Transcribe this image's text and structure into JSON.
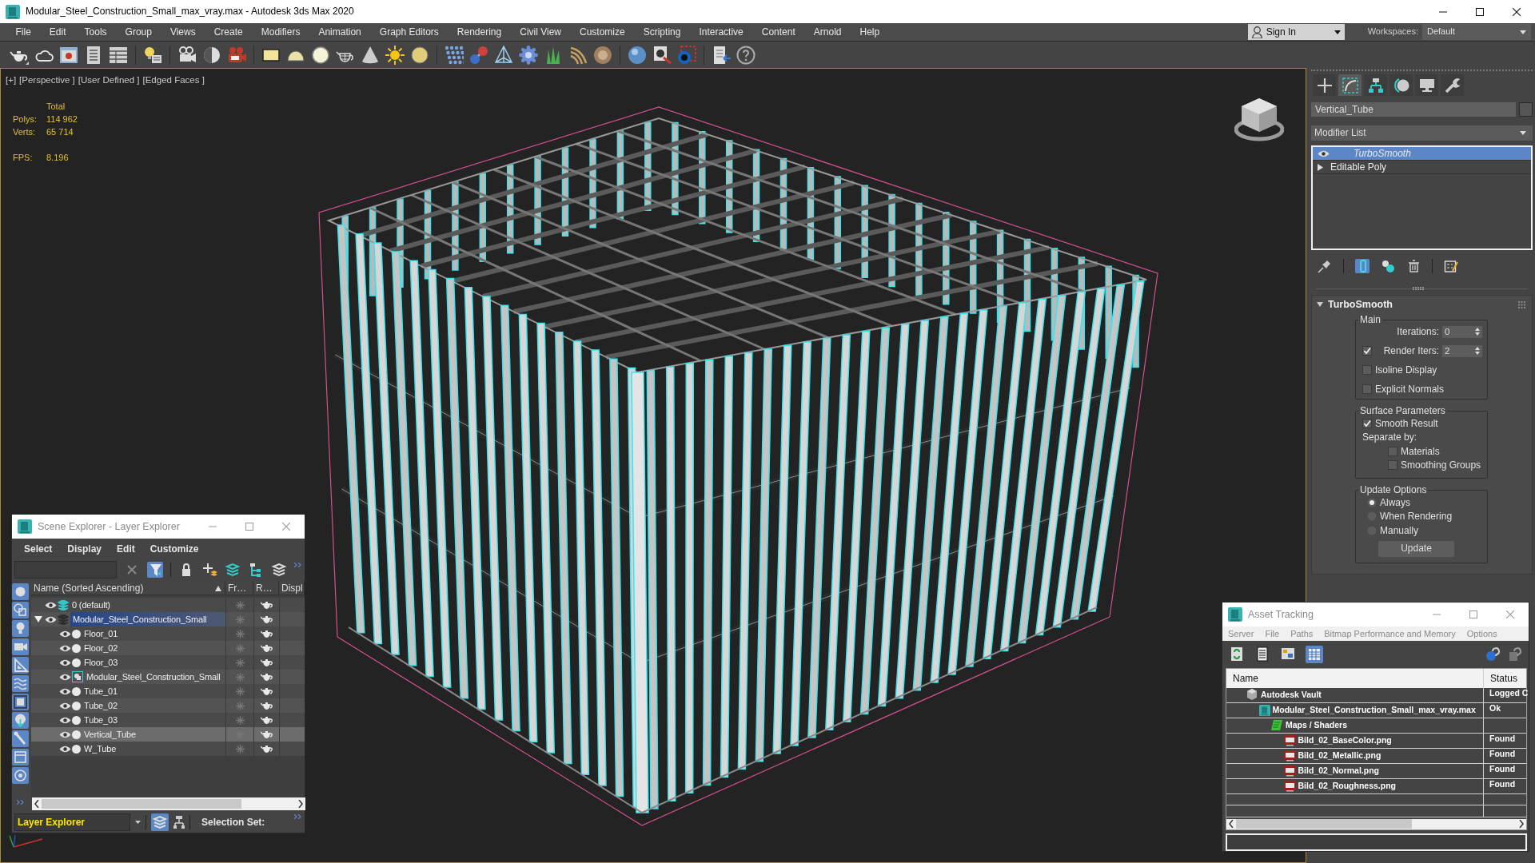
{
  "window": {
    "title": "Modular_Steel_Construction_Small_max_vray.max - Autodesk 3ds Max 2020"
  },
  "menu_bar": {
    "items": [
      "File",
      "Edit",
      "Tools",
      "Group",
      "Views",
      "Create",
      "Modifiers",
      "Animation",
      "Graph Editors",
      "Rendering",
      "Civil View",
      "Customize",
      "Scripting",
      "Interactive",
      "Content",
      "Arnold",
      "Help"
    ],
    "sign_in": "Sign In",
    "workspaces_label": "Workspaces:",
    "workspace": "Default"
  },
  "viewport": {
    "labels": [
      "[+]",
      "[Perspective ]",
      "[User Defined ]",
      "[Edged Faces ]"
    ],
    "stats_header": "Total",
    "stats": [
      {
        "label": "Polys:",
        "value": "114 962"
      },
      {
        "label": "Verts:",
        "value": "65 714"
      }
    ],
    "fps": {
      "label": "FPS:",
      "value": "8.196"
    }
  },
  "command_panel": {
    "tabs": [
      {
        "kind": "create",
        "selected": false
      },
      {
        "kind": "modify",
        "selected": true
      },
      {
        "kind": "hierarchy",
        "selected": false
      },
      {
        "kind": "motion",
        "selected": false
      },
      {
        "kind": "display",
        "selected": false
      },
      {
        "kind": "utilities",
        "selected": false
      }
    ],
    "object_name": "Vertical_Tube",
    "modifier_list": "Modifier List",
    "modifier_stack": [
      {
        "kind": "modifier",
        "label": "TurboSmooth",
        "selected": true
      },
      {
        "kind": "object",
        "label": "Editable Poly",
        "selected": false
      }
    ],
    "stack_tools": [
      {
        "kind": "pin",
        "on": false
      },
      {
        "kind": "end_result",
        "on": true
      },
      {
        "kind": "make_unique",
        "on": false
      },
      {
        "kind": "remove",
        "on": false
      },
      {
        "kind": "configure",
        "on": false
      }
    ],
    "rollout": {
      "title": "TurboSmooth",
      "expanded": true,
      "groups": [
        {
          "title": "Main",
          "controls": [
            {
              "kind": "spinner",
              "label": "Iterations:",
              "value": "0"
            },
            {
              "kind": "checked_spinner",
              "label": "Render Iters:",
              "value": "2",
              "checked": true
            },
            {
              "kind": "checkbox",
              "label": "Isoline Display",
              "checked": false
            },
            {
              "kind": "checkbox",
              "label": "Explicit Normals",
              "checked": false
            }
          ]
        },
        {
          "title": "Surface Parameters",
          "controls": [
            {
              "kind": "checkbox",
              "label": "Smooth Result",
              "checked": true
            },
            {
              "kind": "label",
              "label": "Separate by:",
              "children": [
                {
                  "kind": "checkbox",
                  "label": "Materials",
                  "checked": false
                },
                {
                  "kind": "checkbox",
                  "label": "Smoothing Groups",
                  "checked": false
                }
              ]
            }
          ]
        },
        {
          "title": "Update Options",
          "controls": [
            {
              "kind": "radio",
              "label": "Always",
              "selected": true
            },
            {
              "kind": "radio",
              "label": "When Rendering",
              "selected": false
            },
            {
              "kind": "radio",
              "label": "Manually",
              "selected": false
            },
            {
              "kind": "button",
              "label": "Update"
            }
          ]
        }
      ]
    }
  },
  "scene_explorer": {
    "title": "Scene Explorer - Layer Explorer",
    "menu": [
      "Select",
      "Display",
      "Edit",
      "Customize"
    ],
    "toolbar": [
      {
        "kind": "clear",
        "on": false
      },
      {
        "kind": "filter",
        "on": true
      },
      {
        "kind": "lock",
        "on": false
      },
      {
        "kind": "new_layer",
        "on": false
      },
      {
        "kind": "add_to_layer",
        "on": false
      },
      {
        "kind": "hierarchy",
        "on": false
      },
      {
        "kind": "layers",
        "on": false
      }
    ],
    "side_filters": [
      {
        "kind": "geometry",
        "on": true
      },
      {
        "kind": "shapes",
        "on": true
      },
      {
        "kind": "lights",
        "on": true
      },
      {
        "kind": "cameras",
        "on": true
      },
      {
        "kind": "helpers",
        "on": true
      },
      {
        "kind": "space_warps",
        "on": true
      },
      {
        "kind": "groups",
        "on": true
      },
      {
        "kind": "xrefs",
        "on": true
      },
      {
        "kind": "bones",
        "on": true
      },
      {
        "kind": "containers",
        "on": true
      },
      {
        "kind": "particles",
        "on": true
      }
    ],
    "columns": [
      "Name (Sorted Ascending)",
      "Fr…",
      "R…",
      "Displ"
    ],
    "rows": [
      {
        "kind": "layer",
        "name": "0 (default)",
        "current": true,
        "expanded": false,
        "selected": false,
        "focused": false
      },
      {
        "kind": "layer",
        "name": "Modular_Steel_Construction_Small",
        "current": false,
        "expanded": true,
        "selected": false,
        "focused": true,
        "children": [
          {
            "kind": "object",
            "name": "Floor_01",
            "selected": false,
            "focused": false
          },
          {
            "kind": "object",
            "name": "Floor_02",
            "selected": false,
            "focused": false
          },
          {
            "kind": "object",
            "name": "Floor_03",
            "selected": false,
            "focused": false
          },
          {
            "kind": "group",
            "name": "Modular_Steel_Construction_Small",
            "selected": false,
            "focused": false
          },
          {
            "kind": "object",
            "name": "Tube_01",
            "selected": false,
            "focused": false
          },
          {
            "kind": "object",
            "name": "Tube_02",
            "selected": false,
            "focused": false
          },
          {
            "kind": "object",
            "name": "Tube_03",
            "selected": false,
            "focused": false
          },
          {
            "kind": "object",
            "name": "Vertical_Tube",
            "selected": true,
            "focused": false
          },
          {
            "kind": "object",
            "name": "W_Tube",
            "selected": false,
            "focused": false
          }
        ]
      }
    ],
    "explorer_type": "Layer Explorer",
    "selection_set_label": "Selection Set:"
  },
  "asset_tracking": {
    "title": "Asset Tracking",
    "menu": [
      "Server",
      "File",
      "Paths",
      "Bitmap Performance and Memory",
      "Options"
    ],
    "view_buttons": [
      {
        "kind": "refresh",
        "on": false
      },
      {
        "kind": "list",
        "on": false
      },
      {
        "kind": "thumbnails",
        "on": false
      },
      {
        "kind": "table",
        "on": true
      }
    ],
    "columns": [
      "Name",
      "Status"
    ],
    "rows": [
      {
        "kind": "vault",
        "name": "Autodesk Vault",
        "status": "Logged C",
        "children": [
          {
            "kind": "scene_file",
            "name": "Modular_Steel_Construction_Small_max_vray.max",
            "status": "Ok",
            "children": [
              {
                "kind": "folder",
                "name": "Maps / Shaders",
                "children": [
                  {
                    "kind": "image",
                    "name": "Bild_02_BaseColor.png",
                    "status": "Found"
                  },
                  {
                    "kind": "image",
                    "name": "Bild_02_Metallic.png",
                    "status": "Found"
                  },
                  {
                    "kind": "image",
                    "name": "Bild_02_Normal.png",
                    "status": "Found"
                  },
                  {
                    "kind": "image",
                    "name": "Bild_02_Roughness.png",
                    "status": "Found"
                  }
                ]
              }
            ]
          }
        ]
      }
    ]
  }
}
